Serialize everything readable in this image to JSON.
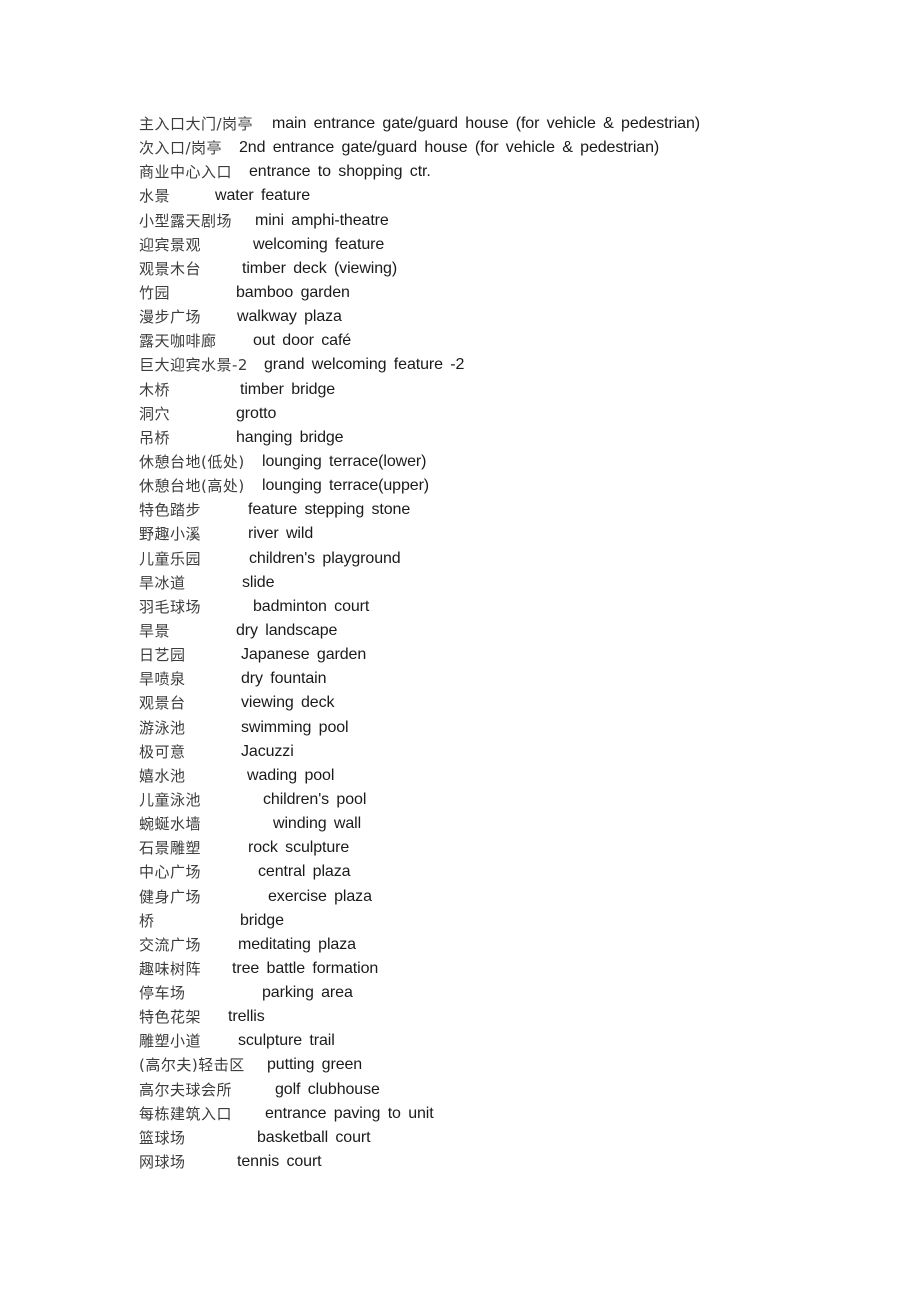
{
  "document": {
    "entries": [
      {
        "zh": "主入口大门/岗亭",
        "en": "main entrance gate/guard house (for vehicle & pedestrian)"
      },
      {
        "zh": "次入口/岗亭",
        "en": "2nd entrance gate/guard house (for vehicle & pedestrian)"
      },
      {
        "zh": "商业中心入口",
        "en": "entrance to shopping ctr."
      },
      {
        "zh": "水景",
        "en": "water feature"
      },
      {
        "zh": "小型露天剧场",
        "en": "mini amphi-theatre"
      },
      {
        "zh": "迎宾景观",
        "en": "welcoming feature"
      },
      {
        "zh": "观景木台",
        "en": "timber deck (viewing)"
      },
      {
        "zh": "竹园",
        "en": "bamboo garden"
      },
      {
        "zh": "漫步广场",
        "en": "walkway plaza"
      },
      {
        "zh": "露天咖啡廊",
        "en": "out door café"
      },
      {
        "zh": "巨大迎宾水景-2",
        "en": "grand welcoming feature -2"
      },
      {
        "zh": "木桥",
        "en": "timber bridge"
      },
      {
        "zh": "洞穴",
        "en": "grotto"
      },
      {
        "zh": "吊桥",
        "en": "hanging bridge"
      },
      {
        "zh": "休憩台地(低处)",
        "en": "lounging terrace(lower)"
      },
      {
        "zh": "休憩台地(高处)",
        "en": "lounging terrace(upper)"
      },
      {
        "zh": "特色踏步",
        "en": "feature stepping stone"
      },
      {
        "zh": "野趣小溪",
        "en": "river wild"
      },
      {
        "zh": "儿童乐园",
        "en": "children's playground"
      },
      {
        "zh": "旱冰道",
        "en": "slide"
      },
      {
        "zh": "羽毛球场",
        "en": "badminton court"
      },
      {
        "zh": "旱景",
        "en": "dry landscape"
      },
      {
        "zh": "日艺园",
        "en": "Japanese garden"
      },
      {
        "zh": "旱喷泉",
        "en": "dry fountain"
      },
      {
        "zh": "观景台",
        "en": "viewing deck"
      },
      {
        "zh": "游泳池",
        "en": "swimming pool"
      },
      {
        "zh": "极可意",
        "en": "Jacuzzi"
      },
      {
        "zh": "嬉水池",
        "en": "wading pool"
      },
      {
        "zh": "儿童泳池",
        "en": "children's pool"
      },
      {
        "zh": "蜿蜒水墙",
        "en": "winding wall"
      },
      {
        "zh": "石景雕塑",
        "en": "rock sculpture"
      },
      {
        "zh": "中心广场",
        "en": "central plaza"
      },
      {
        "zh": "健身广场",
        "en": "exercise plaza"
      },
      {
        "zh": "桥",
        "en": "bridge"
      },
      {
        "zh": "交流广场",
        "en": "meditating plaza"
      },
      {
        "zh": "趣味树阵",
        "en": "tree battle formation"
      },
      {
        "zh": "停车场",
        "en": "parking area"
      },
      {
        "zh": "特色花架",
        "en": "trellis"
      },
      {
        "zh": "雕塑小道",
        "en": "sculpture trail"
      },
      {
        "zh": "(高尔夫)轻击区",
        "en": "putting green"
      },
      {
        "zh": "高尔夫球会所",
        "en": "golf clubhouse"
      },
      {
        "zh": "每栋建筑入口",
        "en": "entrance paving to unit"
      },
      {
        "zh": "篮球场",
        "en": "basketball court"
      },
      {
        "zh": "网球场",
        "en": "tennis court"
      }
    ]
  }
}
